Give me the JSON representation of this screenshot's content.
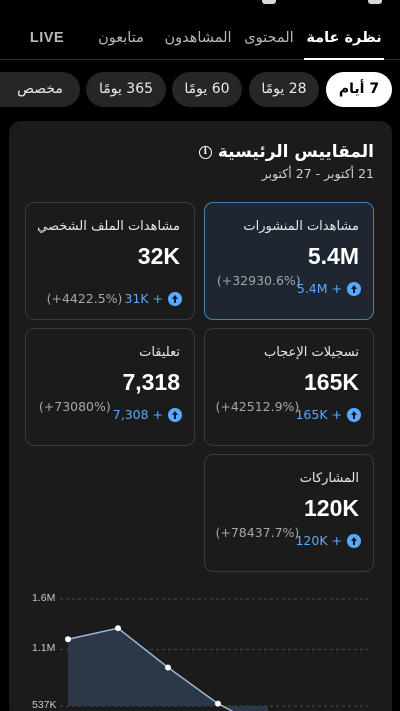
{
  "tabs": [
    {
      "label": "نظرة عامة",
      "active": true
    },
    {
      "label": "المحتوى",
      "active": false
    },
    {
      "label": "المشاهدون",
      "active": false
    },
    {
      "label": "متابعون",
      "active": false
    },
    {
      "label": "LIVE",
      "active": false
    }
  ],
  "date_chips": [
    {
      "label": "7 أيام",
      "active": true
    },
    {
      "label": "28 يومًا",
      "active": false
    },
    {
      "label": "60 يومًا",
      "active": false
    },
    {
      "label": "365 يومًا",
      "active": false
    },
    {
      "label": "مخصص",
      "active": false
    }
  ],
  "metrics_panel": {
    "title": "المقاييس الرئيسية",
    "info_icon": "info-icon",
    "date_range": "21 أكتوبر - 27 أكتوبر"
  },
  "cards": {
    "post_views": {
      "label": "مشاهدات المنشورات",
      "value": "5.4M",
      "delta": "5.4M +",
      "pct": "(+32930.6%)",
      "selected": true
    },
    "profile_views": {
      "label": "مشاهدات الملف الشخصي",
      "value": "32K",
      "delta": "31K +",
      "pct": "(+4422.5%)"
    },
    "likes": {
      "label": "تسجيلات الإعجاب",
      "value": "165K",
      "delta": "165K +",
      "pct": "(+42512.9%)"
    },
    "comments": {
      "label": "تعليقات",
      "value": "7,318",
      "delta": "7,308 +",
      "pct": "(+73080%)"
    },
    "shares": {
      "label": "المشاركات",
      "value": "120K",
      "delta": "120K +",
      "pct": "(+78437.7%)"
    }
  },
  "colors": {
    "accent": "#5aa9ff",
    "selected_card_border": "#4a7fb5",
    "line": "#9db8d6"
  },
  "chart_data": {
    "type": "line",
    "y_tick_labels": [
      "1.6M",
      "1.1M",
      "537K"
    ],
    "y_ticks": [
      1600000,
      1100000,
      537000
    ],
    "ylim": [
      537000,
      1600000
    ],
    "grid": true,
    "series": [
      {
        "values": [
          1200000,
          1310000,
          920000,
          560000,
          300000
        ]
      }
    ]
  }
}
